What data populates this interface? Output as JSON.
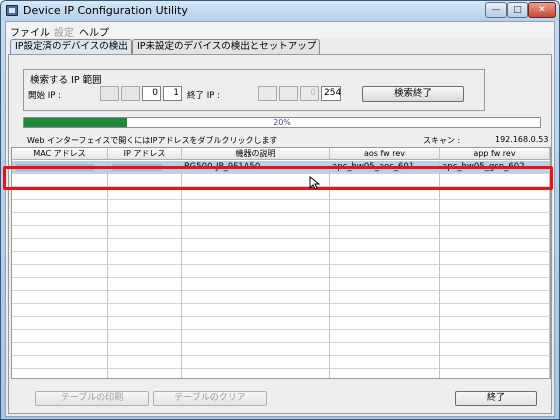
{
  "window": {
    "title": "Device IP Configuration Utility"
  },
  "menu": [
    {
      "label": "ファイル",
      "enabled": true
    },
    {
      "label": "設定",
      "enabled": false
    },
    {
      "label": "ヘルプ",
      "enabled": true
    }
  ],
  "tabs": [
    {
      "label": "IP設定済のデバイスの検出",
      "active": true
    },
    {
      "label": "IP未設定のデバイスの検出とセットアップ",
      "active": false
    }
  ],
  "search": {
    "title": "検索する IP 範囲",
    "start_label": "開始 IP :",
    "start_octets": [
      "",
      "",
      "0",
      "1"
    ],
    "end_label": "終了 IP :",
    "end_octets": [
      "",
      "",
      "0",
      "254"
    ],
    "stop_button": "検索終了"
  },
  "progress": {
    "percent": 20,
    "label": "20%"
  },
  "hint": "Web インターフェイスで開くにはIPアドレスをダブルクリックします",
  "scan": {
    "label": "スキャン :",
    "value": "192.168.0.53"
  },
  "table": {
    "columns": [
      "MAC アドレス",
      "IP アドレス",
      "機器の説明",
      "aos fw rev",
      "app fw rev"
    ],
    "rows": [
      [
        "",
        "",
        "BG500-JP_9F1A50",
        "apc_hw05_aos_601",
        "apc_hw05_gsn_602"
      ]
    ]
  },
  "buttons": {
    "print": "テーブルの印刷",
    "clear": "テーブルのクリア",
    "exit": "終了"
  },
  "colors": {
    "highlight": "#e8121a",
    "progress": "#1f8a3a",
    "selection": "#b8cfe6"
  }
}
